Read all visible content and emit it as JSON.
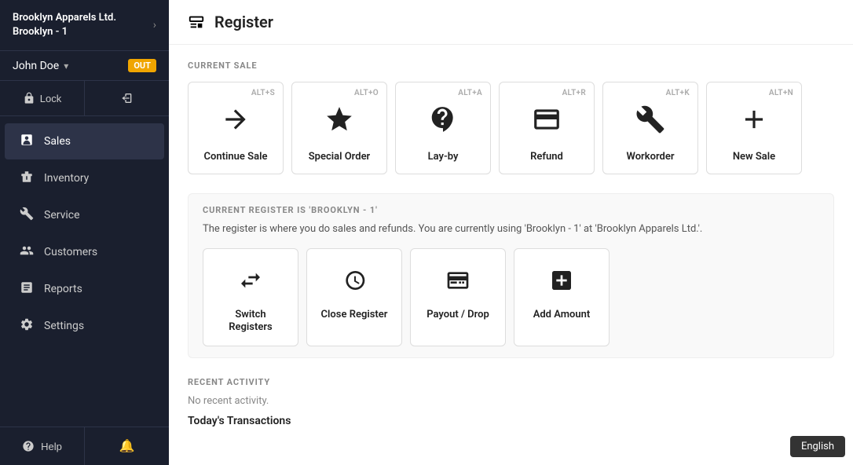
{
  "brand": {
    "name": "Brooklyn Apparels Ltd.",
    "location": "Brooklyn - 1",
    "arrow": "›"
  },
  "user": {
    "name": "John Doe",
    "arrow": "▾",
    "status": "OUT"
  },
  "sidebar_actions": {
    "lock_label": "Lock",
    "logout_icon": "logout"
  },
  "nav": {
    "items": [
      {
        "id": "sales",
        "label": "Sales",
        "icon": "sales"
      },
      {
        "id": "inventory",
        "label": "Inventory",
        "icon": "inventory"
      },
      {
        "id": "service",
        "label": "Service",
        "icon": "service"
      },
      {
        "id": "customers",
        "label": "Customers",
        "icon": "customers"
      },
      {
        "id": "reports",
        "label": "Reports",
        "icon": "reports"
      },
      {
        "id": "settings",
        "label": "Settings",
        "icon": "settings"
      }
    ]
  },
  "bottom": {
    "help_label": "Help",
    "notif_icon": "bell"
  },
  "page": {
    "title": "Register",
    "icon": "register"
  },
  "current_sale": {
    "section_label": "CURRENT SALE",
    "cards": [
      {
        "id": "continue-sale",
        "label": "Continue Sale",
        "shortcut": "ALT+S"
      },
      {
        "id": "special-order",
        "label": "Special Order",
        "shortcut": "ALT+O"
      },
      {
        "id": "lay-by",
        "label": "Lay-by",
        "shortcut": "ALT+A"
      },
      {
        "id": "refund",
        "label": "Refund",
        "shortcut": "ALT+R"
      },
      {
        "id": "workorder",
        "label": "Workorder",
        "shortcut": "ALT+K"
      },
      {
        "id": "new-sale",
        "label": "New Sale",
        "shortcut": "ALT+N"
      }
    ]
  },
  "register_section": {
    "title": "CURRENT REGISTER IS 'BROOKLYN - 1'",
    "description": "The register is where you do sales and refunds. You are currently using 'Brooklyn - 1'  at 'Brooklyn Apparels Ltd.'.",
    "cards": [
      {
        "id": "switch-registers",
        "label": "Switch Registers"
      },
      {
        "id": "close-register",
        "label": "Close Register"
      },
      {
        "id": "payout-drop",
        "label": "Payout / Drop"
      },
      {
        "id": "add-amount",
        "label": "Add Amount"
      }
    ]
  },
  "recent": {
    "section_label": "RECENT ACTIVITY",
    "no_activity": "No recent activity.",
    "today_label": "Today's Transactions"
  },
  "english_badge": "English"
}
